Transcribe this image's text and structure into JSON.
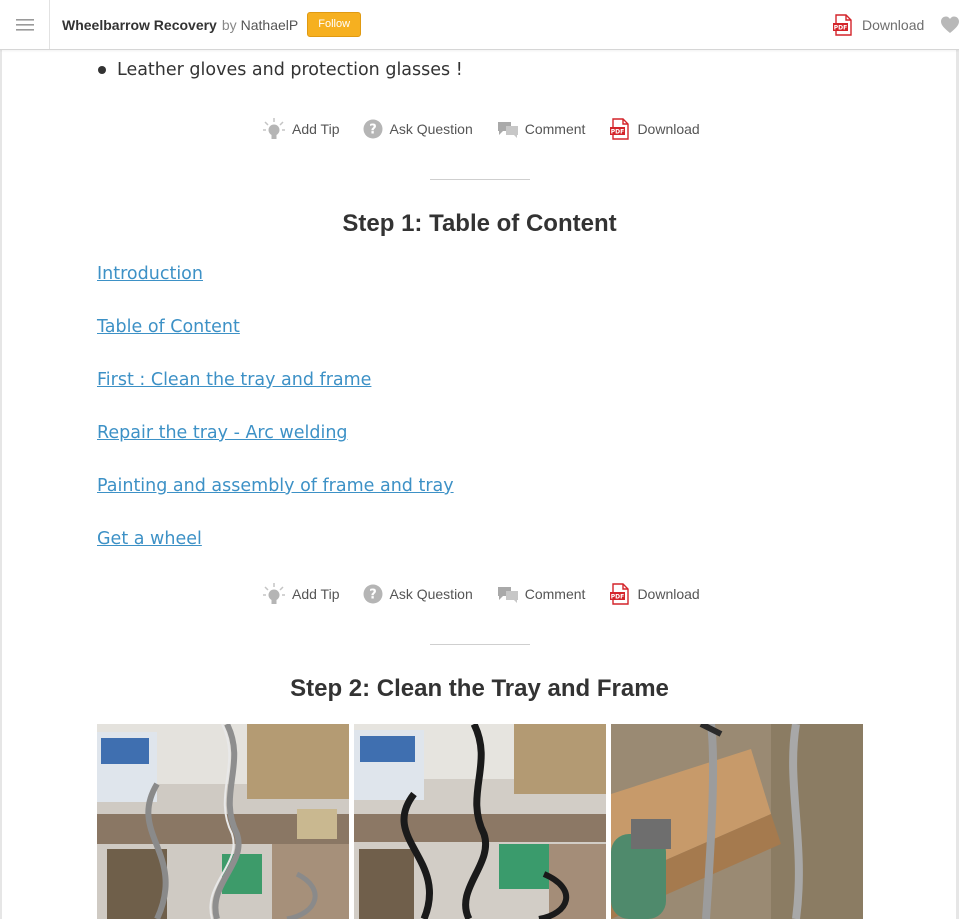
{
  "header": {
    "title": "Wheelbarrow Recovery",
    "by": "by",
    "author": "NathaelP",
    "follow_label": "Follow",
    "download_label": "Download"
  },
  "intro": {
    "bullet": "Leather gloves and protection glasses !"
  },
  "actions": {
    "add_tip": "Add Tip",
    "ask_question": "Ask Question",
    "comment": "Comment",
    "download": "Download"
  },
  "step1": {
    "title": "Step 1: Table of Content",
    "links": [
      "Introduction",
      "Table of Content",
      "First : Clean the tray and frame",
      "Repair the tray - Arc welding",
      "Painting and assembly of frame and tray",
      "Get a wheel"
    ]
  },
  "step2": {
    "title": "Step 2: Clean the Tray and Frame"
  },
  "colors": {
    "link": "#3d91c6",
    "follow": "#f6b020",
    "pdf_red": "#d4242a"
  }
}
